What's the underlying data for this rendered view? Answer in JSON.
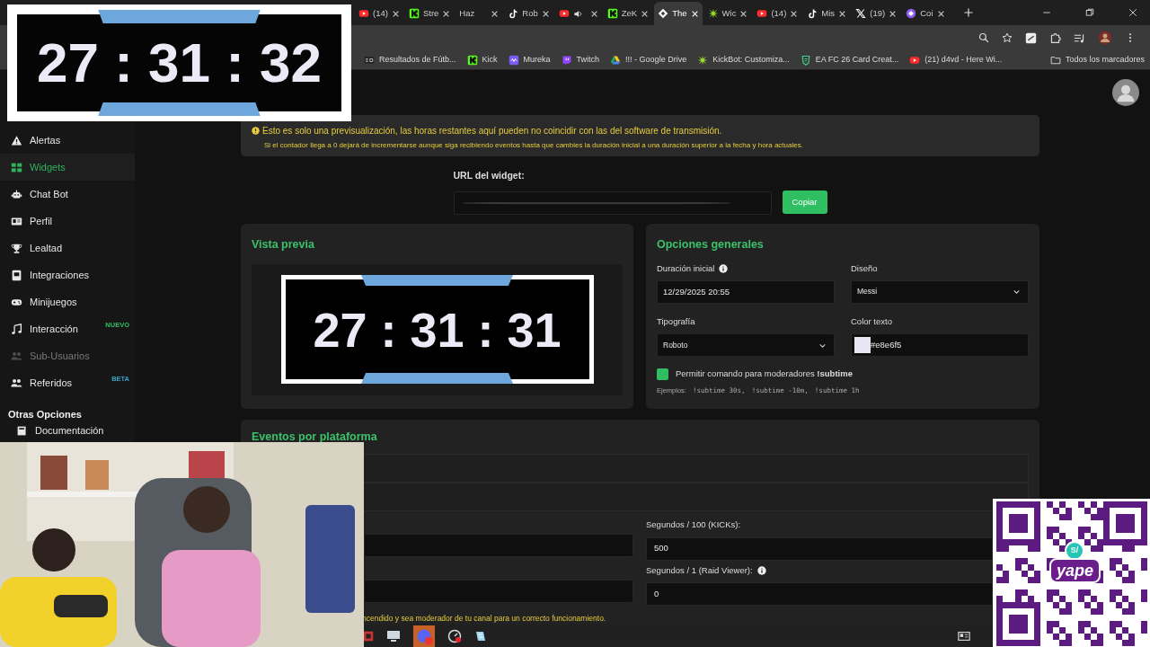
{
  "browser": {
    "tabs": [
      {
        "label": "(14)",
        "selected": false
      },
      {
        "label": "Stre",
        "selected": false
      },
      {
        "label": "Haz",
        "selected": false
      },
      {
        "label": "Rob",
        "selected": false
      },
      {
        "selected": false
      },
      {
        "label": "ZeK",
        "selected": false
      },
      {
        "label": "The",
        "selected": true
      },
      {
        "label": "Wic",
        "selected": false
      },
      {
        "label": "(14)",
        "selected": false
      },
      {
        "label": "Mis",
        "selected": false
      },
      {
        "label": "(19)",
        "selected": false
      },
      {
        "label": "Coi",
        "selected": false
      }
    ],
    "bookmarks": [
      "Resultados de Fútb...",
      "Kick",
      "Mureka",
      "Twitch",
      "!!! - Google Drive",
      "KickBot: Customiza...",
      "EA FC 26 Card Creat...",
      "(21) d4vd - Here Wi..."
    ],
    "all_bookmarks": "Todos los marcadores"
  },
  "sidebar": {
    "items": [
      {
        "label": "Alertas",
        "selected": false,
        "disabled": false
      },
      {
        "label": "Widgets",
        "selected": true,
        "disabled": false
      },
      {
        "label": "Chat Bot",
        "selected": false,
        "disabled": false
      },
      {
        "label": "Perfil",
        "selected": false,
        "disabled": false
      },
      {
        "label": "Lealtad",
        "selected": false,
        "disabled": false
      },
      {
        "label": "Integraciones",
        "selected": false,
        "disabled": false
      },
      {
        "label": "Minijuegos",
        "selected": false,
        "disabled": false
      },
      {
        "label": "Interacción",
        "selected": false,
        "disabled": false,
        "badge": "NUEVO"
      },
      {
        "label": "Sub-Usuarios",
        "selected": false,
        "disabled": true
      },
      {
        "label": "Referidos",
        "selected": false,
        "disabled": false,
        "badge": "BETA"
      }
    ],
    "section": "Otras Opciones",
    "more": [
      "Documentación"
    ]
  },
  "notice": {
    "lines": [
      "Esto es solo una previsualización, las horas restantes aquí pueden no coincidir con las del software de transmisión.",
      "Si el contador llega a 0 dejará de incrementarse aunque siga recibiendo eventos hasta que cambies la duración inicial a una duración superior a la fecha y hora actuales."
    ]
  },
  "widget_url": {
    "label": "URL del widget:",
    "button": "Copiar"
  },
  "preview": {
    "title": "Vista previa",
    "time": "27 : 31 : 31"
  },
  "options": {
    "title": "Opciones generales",
    "fields": [
      {
        "kind": "text",
        "label": "Duración inicial",
        "info": true,
        "value": "12/29/2025 20:55"
      },
      {
        "kind": "select",
        "label": "Diseño",
        "info": false,
        "value": "Messi"
      },
      {
        "kind": "select",
        "label": "Tipografía",
        "info": false,
        "value": "Roboto"
      },
      {
        "kind": "color",
        "label": "Color texto",
        "info": false,
        "value": "#e8e6f5",
        "color": "#e8e6f5"
      }
    ],
    "moderator_command": {
      "checked": true,
      "label": "Permitir comando para moderadores **!subtime**"
    },
    "examples_label": "Ejemplos:",
    "examples": [
      "!subtime 30s,",
      "!subtime -10m,",
      "!subtime 1h"
    ]
  },
  "events": {
    "title": "Eventos por plataforma",
    "fields": [
      {
        "label": "Segundos / 100 (KICKs):",
        "info": false,
        "value": "500"
      },
      {
        "label": "Segundos / 1 (Raid Viewer):",
        "info": true,
        "value": "0"
      }
    ],
    "footnote": "ncendido y sea moderador de tu canal para un correcto funcionamiento."
  },
  "timer_overlay": {
    "time": "27 : 31 : 32"
  },
  "qr": {
    "badge": "S/",
    "logo": "yape"
  }
}
